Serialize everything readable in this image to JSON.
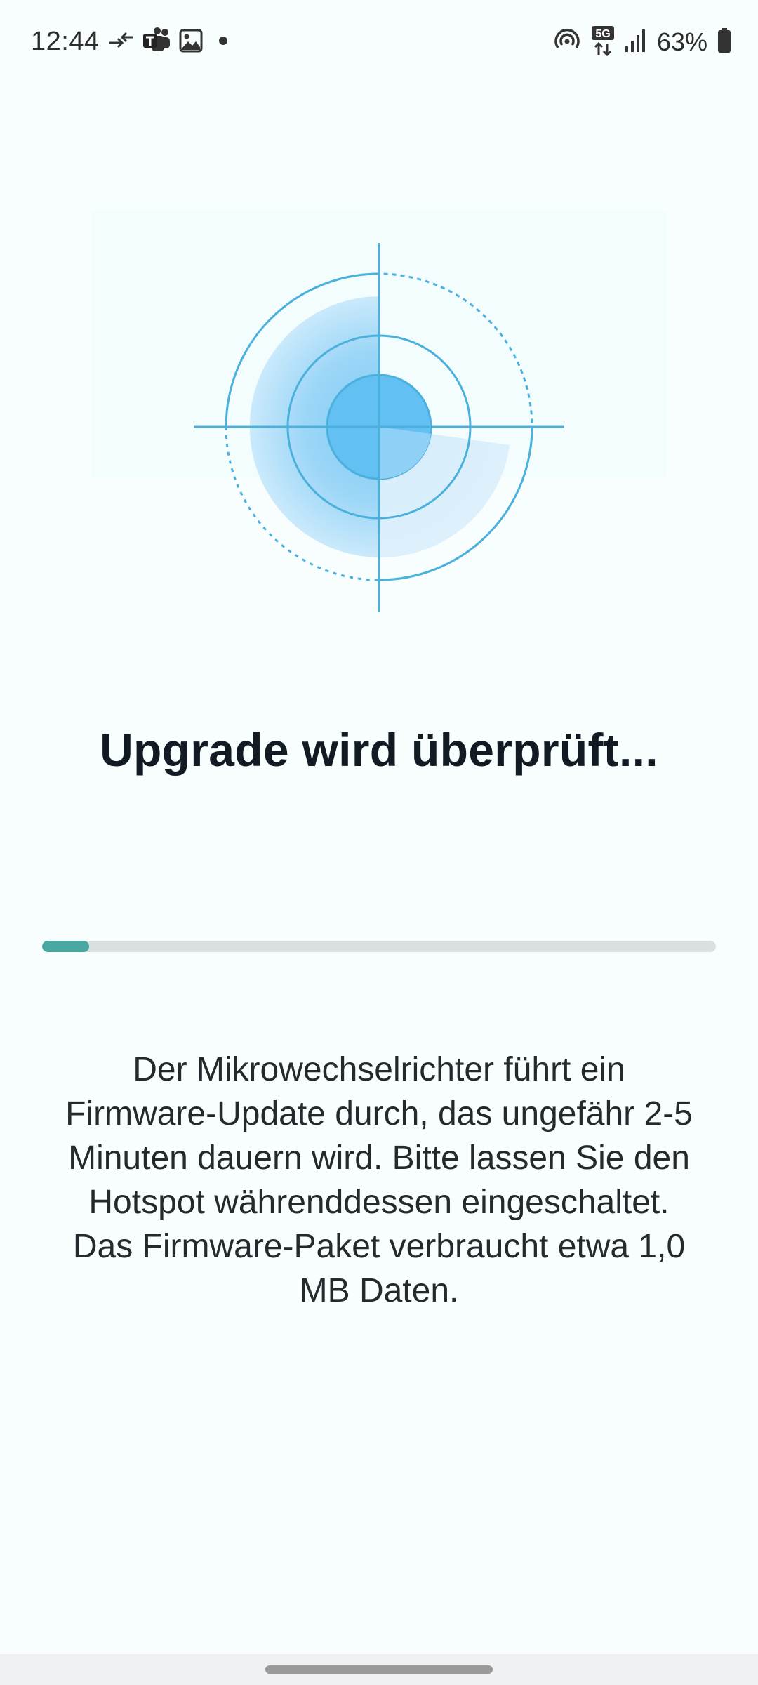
{
  "status_bar": {
    "time": "12:44",
    "battery": "63%",
    "network": "5G",
    "icons": [
      "data-transfer-icon",
      "teams-icon",
      "gallery-icon",
      "notification-dot-icon",
      "hotspot-icon",
      "5g-signal-icon",
      "signal-bars-icon",
      "battery-icon"
    ]
  },
  "illustration": {
    "icon": "radar-scan-icon",
    "colors": {
      "ring": "#4ab0dc",
      "fill_light": "#c3e6fb",
      "fill_mid": "#8fd0f6",
      "core": "#62c0f2"
    }
  },
  "main": {
    "title": "Upgrade wird überprüft...",
    "progress": 0.07,
    "description": "Der Mikrowechselrichter führt ein Firmware-Update durch, das ungefähr 2-5 Minuten dauern wird. Bitte lassen Sie den Hotspot währenddessen eingeschaltet. Das Firmware-Paket verbraucht etwa 1,0 MB Daten."
  },
  "colors": {
    "background": "#f7fefd",
    "progress_fill": "#4aa8a2",
    "progress_track": "#dcdfe2",
    "title": "#121a23"
  }
}
